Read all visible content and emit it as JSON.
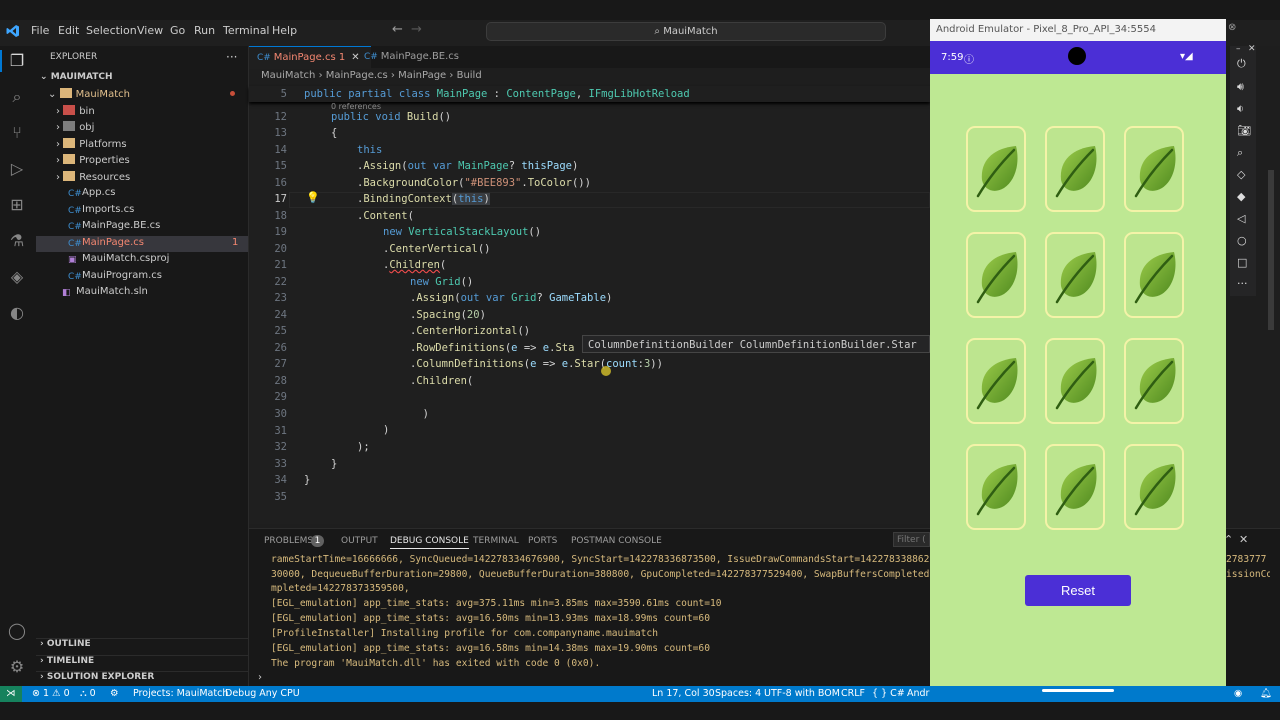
{
  "menu": [
    "File",
    "Edit",
    "Selection",
    "View",
    "Go",
    "Run",
    "Terminal",
    "Help"
  ],
  "command_center": "MauiMatch",
  "explorer": {
    "title": "EXPLORER",
    "root": "MAUIMATCH",
    "items": [
      "MauiMatch",
      "bin",
      "obj",
      "Platforms",
      "Properties",
      "Resources",
      "App.cs",
      "Imports.cs",
      "MainPage.BE.cs",
      "MainPage.cs",
      "MauiMatch.csproj",
      "MauiProgram.cs",
      "MauiMatch.sln"
    ],
    "mainpage_badge": "1",
    "sections": [
      "OUTLINE",
      "TIMELINE",
      "SOLUTION EXPLORER"
    ]
  },
  "tabs": [
    {
      "label": "MainPage.cs 1"
    },
    {
      "label": "MainPage.BE.cs"
    }
  ],
  "breadcrumb": [
    "MauiMatch",
    "MainPage.cs",
    "MainPage",
    "Build"
  ],
  "code": {
    "sticky_line": "5",
    "references": "0 references",
    "lines": [
      "12",
      "13",
      "14",
      "15",
      "16",
      "17",
      "18",
      "19",
      "20",
      "21",
      "22",
      "23",
      "24",
      "25",
      "26",
      "27",
      "28",
      "29",
      "30",
      "31",
      "32",
      "33",
      "34",
      "35"
    ]
  },
  "hover_text": "ColumnDefinitionBuilder ColumnDefinitionBuilder.Star",
  "panel": {
    "tabs": [
      "PROBLEMS",
      "1",
      "OUTPUT",
      "DEBUG CONSOLE",
      "TERMINAL",
      "PORTS",
      "POSTMAN CONSOLE"
    ],
    "filter_placeholder": "Filter (e.g.",
    "lines": [
      "rameStartTime=16666666, SyncQueued=142278334676900, SyncStart=142278336873500, IssueDrawCommandsStart=1422783388620",
      "30000, DequeueBufferDuration=29800, QueueBufferDuration=380800, GpuCompleted=142278377529400, SwapBuffersCompleted",
      "mpleted=142278373359500,",
      "[EGL_emulation] app_time_stats: avg=375.11ms min=3.85ms max=3590.61ms count=10",
      "[EGL_emulation] app_time_stats: avg=16.50ms min=13.93ms max=18.99ms count=60",
      "[ProfileInstaller] Installing profile for com.companyname.mauimatch",
      "[EGL_emulation] app_time_stats: avg=16.58ms min=14.38ms max=19.90ms count=60",
      "The program 'MauiMatch.dll' has exited with code 0 (0x0)."
    ],
    "overflow_right": [
      "2783777",
      "issionCo"
    ]
  },
  "status": {
    "errors": "1",
    "warnings": "0",
    "ports": "0",
    "project": "Projects: MauiMatch",
    "config": "Debug Any CPU",
    "position": "Ln 17, Col 30",
    "spaces": "Spaces: 4",
    "encoding": "UTF-8 with BOM",
    "eol": "CRLF",
    "lang": "{ } C#",
    "android": "Andr"
  },
  "emulator": {
    "title": "Android Emulator - Pixel_8_Pro_API_34:5554",
    "time": "7:59",
    "reset_label": "Reset",
    "colors": {
      "background": "#BEE893",
      "accent": "#4B2FD6",
      "card_border": "#F4F3A8"
    }
  }
}
